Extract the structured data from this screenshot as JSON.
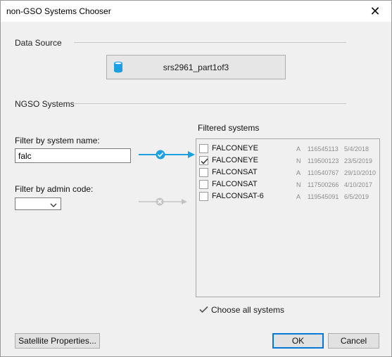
{
  "window": {
    "title": "non-GSO Systems Chooser",
    "close_glyph": "✕"
  },
  "data_source": {
    "section_label": "Data Source",
    "button_label": "srs2961_part1of3",
    "icon": "database-icon"
  },
  "ngso": {
    "section_label": "NGSO Systems",
    "filter_name_label": "Filter by system name:",
    "filter_name_value": "falc",
    "filter_admin_label": "Filter by admin code:",
    "filter_admin_value": "",
    "name_filter_active": true,
    "admin_filter_active": false
  },
  "filtered": {
    "label": "Filtered systems",
    "systems": [
      {
        "name": "FALCONEYE",
        "code": "A",
        "id": "116545113",
        "date": "5/4/2018",
        "checked": false
      },
      {
        "name": "FALCONEYE",
        "code": "N",
        "id": "119500123",
        "date": "23/5/2019",
        "checked": true
      },
      {
        "name": "FALCONSAT",
        "code": "A",
        "id": "110540767",
        "date": "29/10/2010",
        "checked": false
      },
      {
        "name": "FALCONSAT",
        "code": "N",
        "id": "117500266",
        "date": "4/10/2017",
        "checked": false
      },
      {
        "name": "FALCONSAT-6",
        "code": "A",
        "id": "119545091",
        "date": "6/5/2019",
        "checked": false
      }
    ],
    "choose_all_label": "Choose all systems"
  },
  "buttons": {
    "satellite_properties": "Satellite Properties...",
    "ok": "OK",
    "cancel": "Cancel"
  },
  "colors": {
    "accent": "#1ba1e2",
    "inactive": "#c3c3c3",
    "window_bg": "#f0f0f0",
    "default_button_border": "#0078d7"
  }
}
